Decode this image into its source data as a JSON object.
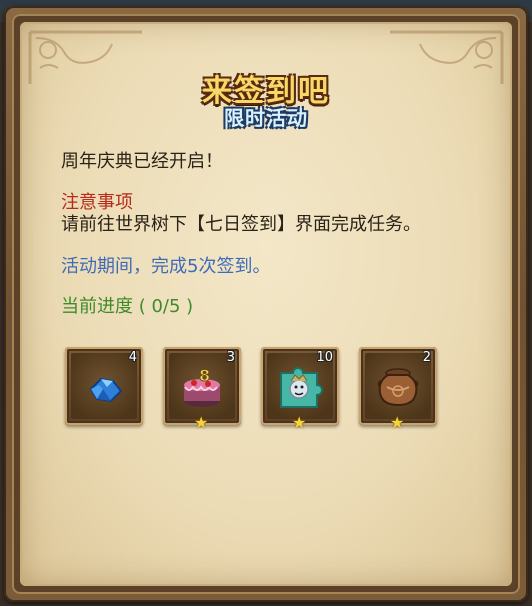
{
  "title": {
    "main": "来签到吧",
    "sub": "限时活动"
  },
  "body": {
    "line1": "周年庆典已经开启！",
    "notice_heading": "注意事项",
    "notice_text": "请前往世界树下【七日签到】界面完成任务。",
    "period_text": "活动期间，完成5次签到。",
    "progress_text": "当前进度 ( 0/5 )"
  },
  "rewards": [
    {
      "icon": "blue-crystal-icon",
      "count": "4",
      "starred": false
    },
    {
      "icon": "birthday-cake-icon",
      "count": "3",
      "starred": true
    },
    {
      "icon": "puzzle-piece-icon",
      "count": "10",
      "starred": true
    },
    {
      "icon": "clay-jar-icon",
      "count": "2",
      "starred": true
    }
  ],
  "colors": {
    "title_gold": "#f8d867",
    "subtitle_blue": "#d9f1ff",
    "notice_red": "#b62a1c",
    "period_blue": "#3f6bb8",
    "progress_green": "#3d8b2d",
    "parchment": "#ecdcb6"
  }
}
